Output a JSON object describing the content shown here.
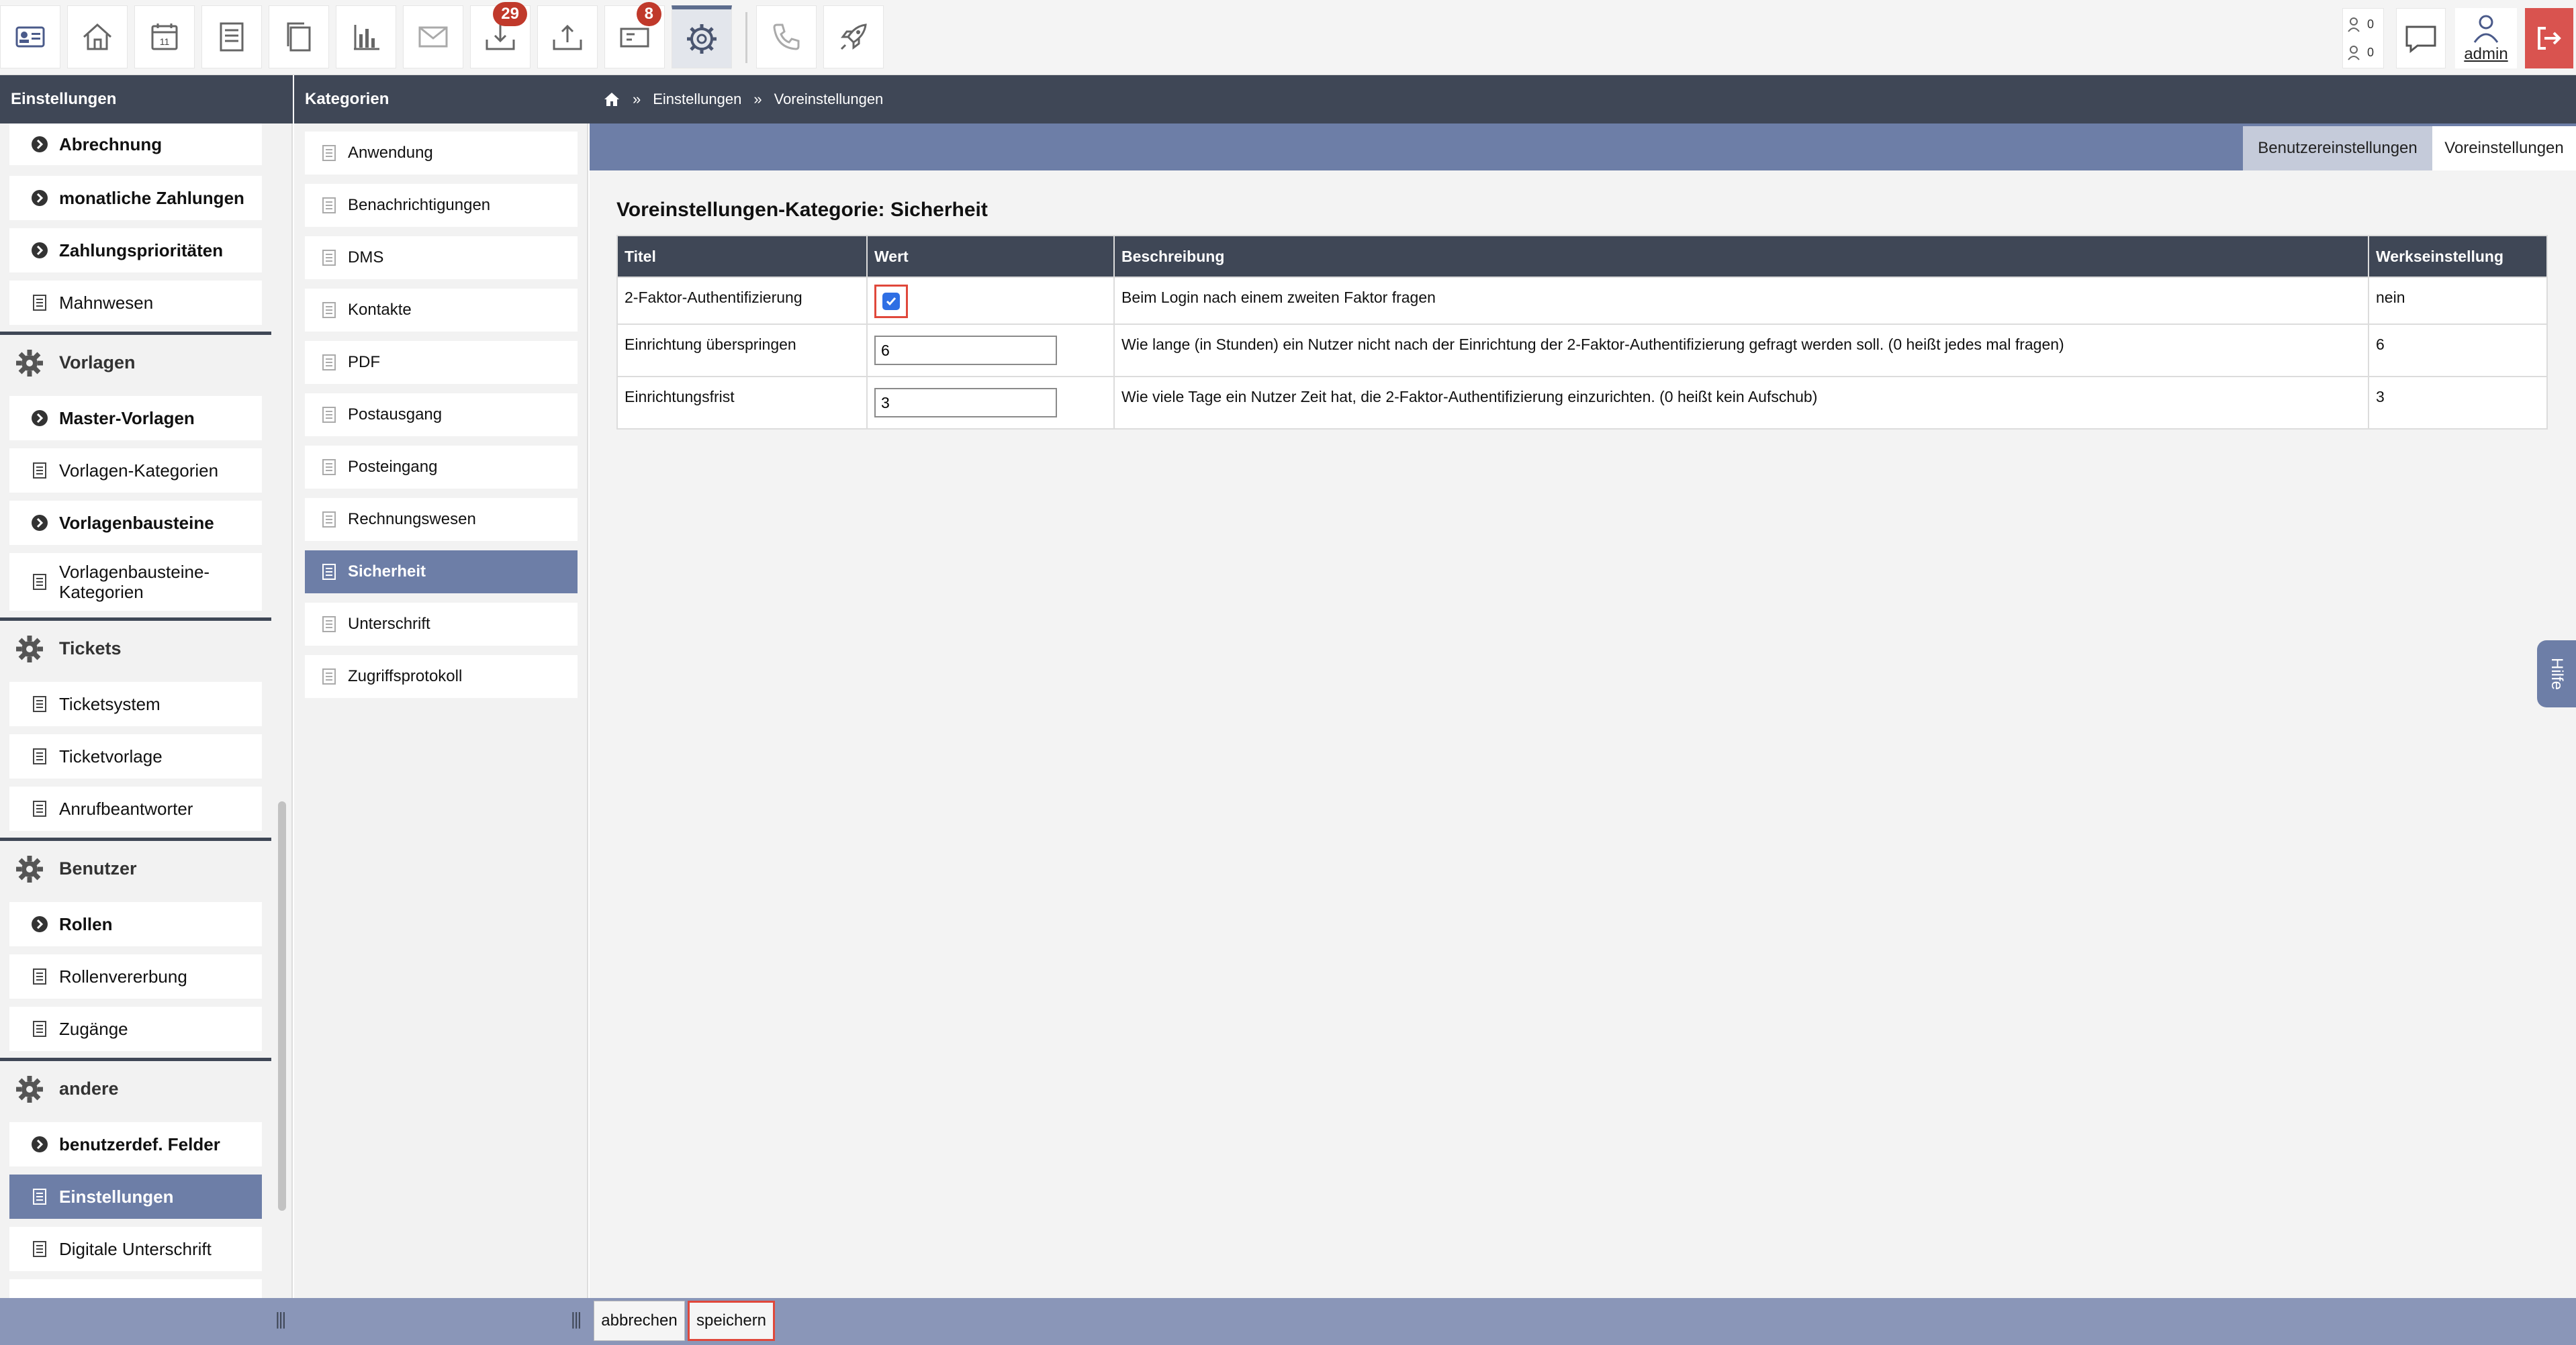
{
  "toolbar": {
    "buttons": [
      {
        "name": "contacts",
        "icon": "address-card-icon"
      },
      {
        "name": "home",
        "icon": "home-icon"
      },
      {
        "name": "calendar",
        "icon": "calendar-icon",
        "day": "11"
      },
      {
        "name": "document",
        "icon": "document-icon"
      },
      {
        "name": "files",
        "icon": "files-icon"
      },
      {
        "name": "statistics",
        "icon": "bar-chart-icon"
      },
      {
        "name": "mail",
        "icon": "envelope-icon"
      },
      {
        "name": "inbox",
        "icon": "inbox-download-icon",
        "badge": "29"
      },
      {
        "name": "outbox",
        "icon": "outbox-upload-icon"
      },
      {
        "name": "tickets",
        "icon": "ticket-icon",
        "badge": "8"
      },
      {
        "name": "settings",
        "icon": "gear-icon",
        "active": true
      },
      {
        "name": "phone",
        "icon": "phone-icon"
      },
      {
        "name": "rocket",
        "icon": "rocket-icon"
      }
    ],
    "count_a": "0",
    "count_b": "0",
    "user_label": "admin"
  },
  "left": {
    "header": "Einstellungen",
    "items": [
      {
        "label": "Abrechnung",
        "type": "group-link"
      },
      {
        "label": "monatliche Zahlungen",
        "type": "group-link"
      },
      {
        "label": "Zahlungsprioritäten",
        "type": "group-link"
      },
      {
        "label": "Mahnwesen",
        "type": "page"
      },
      {
        "label": "Vorlagen",
        "type": "section"
      },
      {
        "label": "Master-Vorlagen",
        "type": "group-link"
      },
      {
        "label": "Vorlagen-Kategorien",
        "type": "page"
      },
      {
        "label": "Vorlagenbausteine",
        "type": "group-link"
      },
      {
        "label": "Vorlagenbausteine-Kategorien",
        "type": "page"
      },
      {
        "label": "Tickets",
        "type": "section"
      },
      {
        "label": "Ticketsystem",
        "type": "page"
      },
      {
        "label": "Ticketvorlage",
        "type": "page"
      },
      {
        "label": "Anrufbeantworter",
        "type": "page"
      },
      {
        "label": "Benutzer",
        "type": "section"
      },
      {
        "label": "Rollen",
        "type": "group-link"
      },
      {
        "label": "Rollenvererbung",
        "type": "page"
      },
      {
        "label": "Zugänge",
        "type": "page"
      },
      {
        "label": "andere",
        "type": "section"
      },
      {
        "label": "benutzerdef. Felder",
        "type": "group-link"
      },
      {
        "label": "Einstellungen",
        "type": "page",
        "selected": true
      },
      {
        "label": "Digitale Unterschrift",
        "type": "page"
      }
    ]
  },
  "middle": {
    "header": "Kategorien",
    "items": [
      {
        "label": "Anwendung"
      },
      {
        "label": "Benachrichtigungen"
      },
      {
        "label": "DMS"
      },
      {
        "label": "Kontakte"
      },
      {
        "label": "PDF"
      },
      {
        "label": "Postausgang"
      },
      {
        "label": "Posteingang"
      },
      {
        "label": "Rechnungswesen"
      },
      {
        "label": "Sicherheit",
        "selected": true
      },
      {
        "label": "Unterschrift"
      },
      {
        "label": "Zugriffsprotokoll"
      }
    ]
  },
  "breadcrumb": {
    "sep": "»",
    "items": [
      "Einstellungen",
      "Voreinstellungen"
    ]
  },
  "tabs": {
    "user_settings": "Benutzereinstellungen",
    "defaults": "Voreinstellungen",
    "active": "Voreinstellungen"
  },
  "main": {
    "title": "Voreinstellungen-Kategorie: Sicherheit",
    "columns": [
      "Titel",
      "Wert",
      "Beschreibung",
      "Werkseinstellung"
    ],
    "rows": [
      {
        "title": "2-Faktor-Authentifizierung",
        "value_type": "checkbox",
        "checked": true,
        "description": "Beim Login nach einem zweiten Faktor fragen",
        "default": "nein"
      },
      {
        "title": "Einrichtung überspringen",
        "value_type": "text",
        "value": "6",
        "description": "Wie lange (in Stunden) ein Nutzer nicht nach der Einrichtung der 2-Faktor-Authentifizierung gefragt werden soll. (0 heißt jedes mal fragen)",
        "default": "6"
      },
      {
        "title": "Einrichtungsfrist",
        "value_type": "text",
        "value": "3",
        "description": "Wie viele Tage ein Nutzer Zeit hat, die 2-Faktor-Authentifizierung einzurichten. (0 heißt kein Aufschub)",
        "default": "3"
      }
    ]
  },
  "help_tab": "Hilfe",
  "footer": {
    "grip": "|||",
    "cancel": "abbrechen",
    "save": "speichern"
  },
  "colors": {
    "header_dark": "#3f4756",
    "accent": "#6d7ea7",
    "footer": "#8a96b8",
    "badge": "#c0392b",
    "highlight_border": "#e0483b",
    "logout": "#d9534f"
  }
}
